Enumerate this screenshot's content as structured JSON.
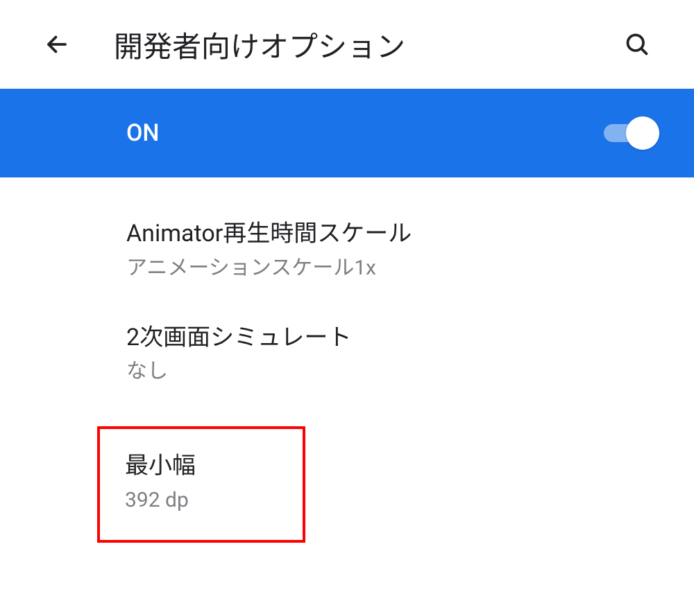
{
  "header": {
    "title": "開発者向けオプション"
  },
  "master_toggle": {
    "label": "ON",
    "state": true
  },
  "settings": {
    "animator": {
      "title": "Animator再生時間スケール",
      "subtitle": "アニメーションスケール1x"
    },
    "secondary_display": {
      "title": "2次画面シミュレート",
      "subtitle": "なし"
    },
    "smallest_width": {
      "title": "最小幅",
      "subtitle": "392 dp"
    }
  }
}
